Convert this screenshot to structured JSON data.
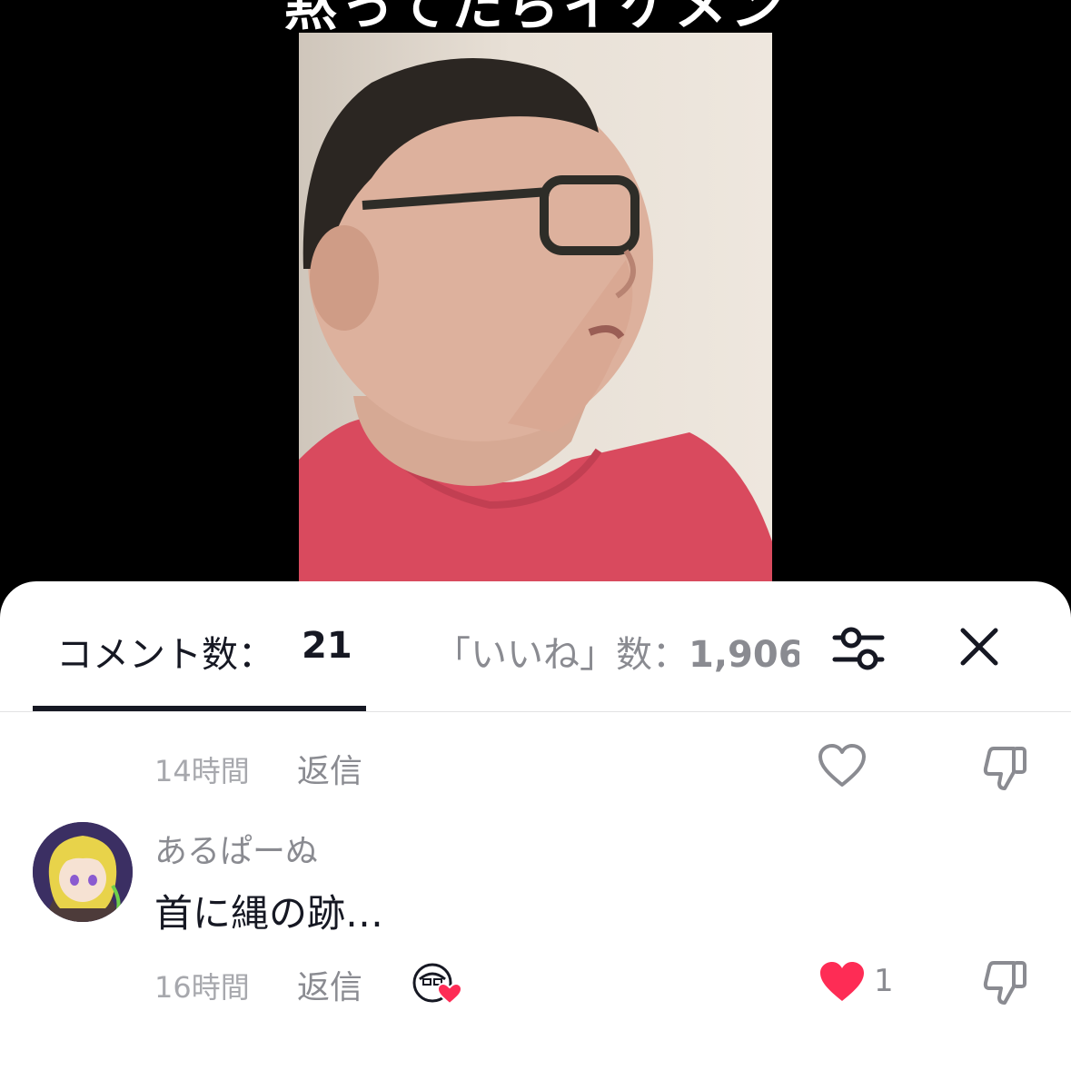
{
  "video": {
    "caption": "黙ってたらイケメン"
  },
  "header": {
    "comments_label": "コメント数：",
    "comments_count": "21",
    "likes_label": "「いいね」数：",
    "likes_count": "1,906",
    "filter_icon": "sliders-icon",
    "close_icon": "close-icon"
  },
  "comments": [
    {
      "time": "14時間",
      "reply_label": "返信",
      "like_icon": "heart-outline-icon",
      "dislike_icon": "thumbs-down-icon"
    },
    {
      "username": "あるぱーぬ",
      "text": "首に縄の跡…",
      "time": "16時間",
      "reply_label": "返信",
      "creator_liked_icon": "creator-liked-icon",
      "like_icon": "heart-filled-icon",
      "like_count": "1",
      "dislike_icon": "thumbs-down-icon"
    }
  ],
  "colors": {
    "like_red": "#fe2c55",
    "text_primary": "#161823",
    "text_secondary": "#8a8b91"
  }
}
